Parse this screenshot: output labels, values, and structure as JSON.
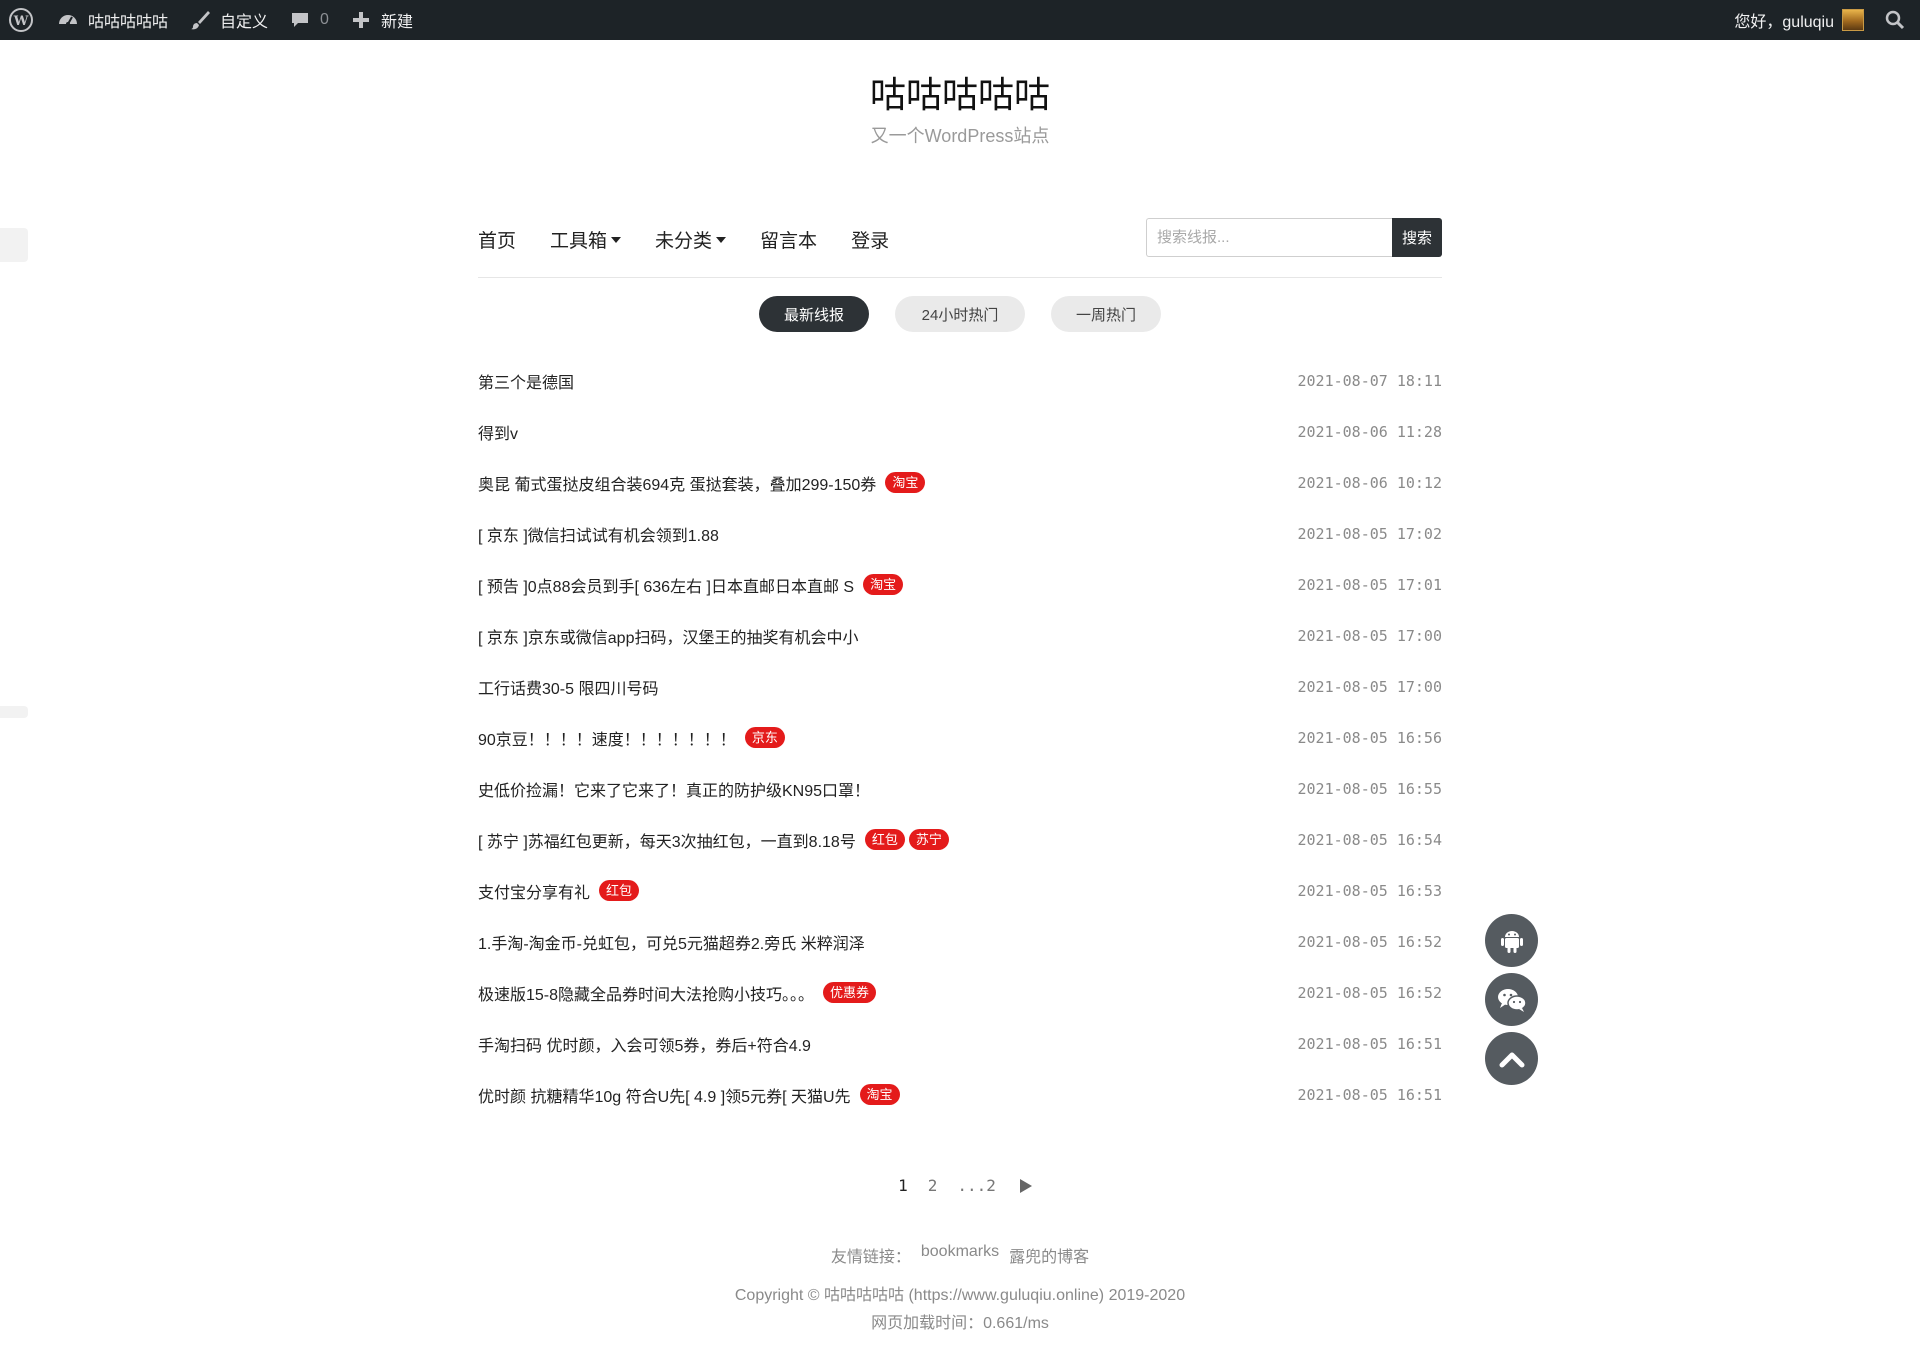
{
  "adminbar": {
    "site_name": "咕咕咕咕咕",
    "customize": "自定义",
    "comments_count": "0",
    "new": "新建",
    "greeting": "您好，guluqiu"
  },
  "header": {
    "title": "咕咕咕咕咕",
    "description": "又一个WordPress站点"
  },
  "nav": {
    "items": [
      {
        "label": "首页",
        "dropdown": false
      },
      {
        "label": "工具箱",
        "dropdown": true
      },
      {
        "label": "未分类",
        "dropdown": true
      },
      {
        "label": "留言本",
        "dropdown": false
      },
      {
        "label": "登录",
        "dropdown": false
      }
    ],
    "search_placeholder": "搜索线报...",
    "search_button": "搜索"
  },
  "tabs": [
    {
      "label": "最新线报",
      "active": true
    },
    {
      "label": "24小时热门",
      "active": false
    },
    {
      "label": "一周热门",
      "active": false
    }
  ],
  "posts": [
    {
      "title": "第三个是德国",
      "tags": [],
      "date": "2021-08-07 18:11"
    },
    {
      "title": "得到v",
      "tags": [],
      "date": "2021-08-06 11:28"
    },
    {
      "title": "奥昆 葡式蛋挞皮组合装694克 蛋挞套装，叠加299-150券",
      "tags": [
        "淘宝"
      ],
      "date": "2021-08-06 10:12"
    },
    {
      "title": "[ 京东 ]微信扫试试有机会领到1.88",
      "tags": [],
      "date": "2021-08-05 17:02"
    },
    {
      "title": "[ 预告 ]0点88会员到手[ 636左右 ]日本直邮日本直邮 S",
      "tags": [
        "淘宝"
      ],
      "date": "2021-08-05 17:01"
    },
    {
      "title": "[ 京东 ]京东或微信app扫码，汉堡王的抽奖有机会中小",
      "tags": [],
      "date": "2021-08-05 17:00"
    },
    {
      "title": "工行话费30-5 限四川号码",
      "tags": [],
      "date": "2021-08-05 17:00"
    },
    {
      "title": "90京豆！！！！速度！！！！！！！",
      "tags": [
        "京东"
      ],
      "date": "2021-08-05 16:56"
    },
    {
      "title": "史低价捡漏！它来了它来了！真正的防护级KN95口罩！",
      "tags": [],
      "date": "2021-08-05 16:55"
    },
    {
      "title": "[ 苏宁 ]苏福红包更新，每天3次抽红包，一直到8.18号",
      "tags": [
        "红包",
        "苏宁"
      ],
      "date": "2021-08-05 16:54"
    },
    {
      "title": "支付宝分享有礼",
      "tags": [
        "红包"
      ],
      "date": "2021-08-05 16:53"
    },
    {
      "title": "1.手淘-淘金币-兑虹包，可兑5元猫超券2.旁氏 米粹润泽",
      "tags": [],
      "date": "2021-08-05 16:52"
    },
    {
      "title": "极速版15-8隐藏全品券时间大法抢购小技巧。。。",
      "tags": [
        "优惠券"
      ],
      "date": "2021-08-05 16:52"
    },
    {
      "title": "手淘扫码 优时颜，入会可领5券，券后+符合4.9",
      "tags": [],
      "date": "2021-08-05 16:51"
    },
    {
      "title": "优时颜 抗糖精华10g 符合U先[ 4.9 ]领5元券[ 天猫U先",
      "tags": [
        "淘宝"
      ],
      "date": "2021-08-05 16:51"
    }
  ],
  "pagination": {
    "current": "1",
    "pages": [
      "2"
    ],
    "ellipsis": "...2"
  },
  "footer": {
    "links_label": "友情链接：",
    "links": [
      "bookmarks",
      "露兜的博客"
    ],
    "copyright": "Copyright © 咕咕咕咕咕 (https://www.guluqiu.online) 2019-2020",
    "load_time": "网页加载时间：0.661/ms"
  },
  "colors": {
    "admin_bar": "#1d2327",
    "accent_dark": "#2d3236",
    "tag_red": "#e41b1b",
    "float_button": "#555b60"
  },
  "icons": [
    "wordpress-icon",
    "dashboard-icon",
    "brush-icon",
    "comment-icon",
    "plus-icon",
    "search-icon",
    "android-icon",
    "wechat-icon",
    "chevron-up-icon"
  ]
}
